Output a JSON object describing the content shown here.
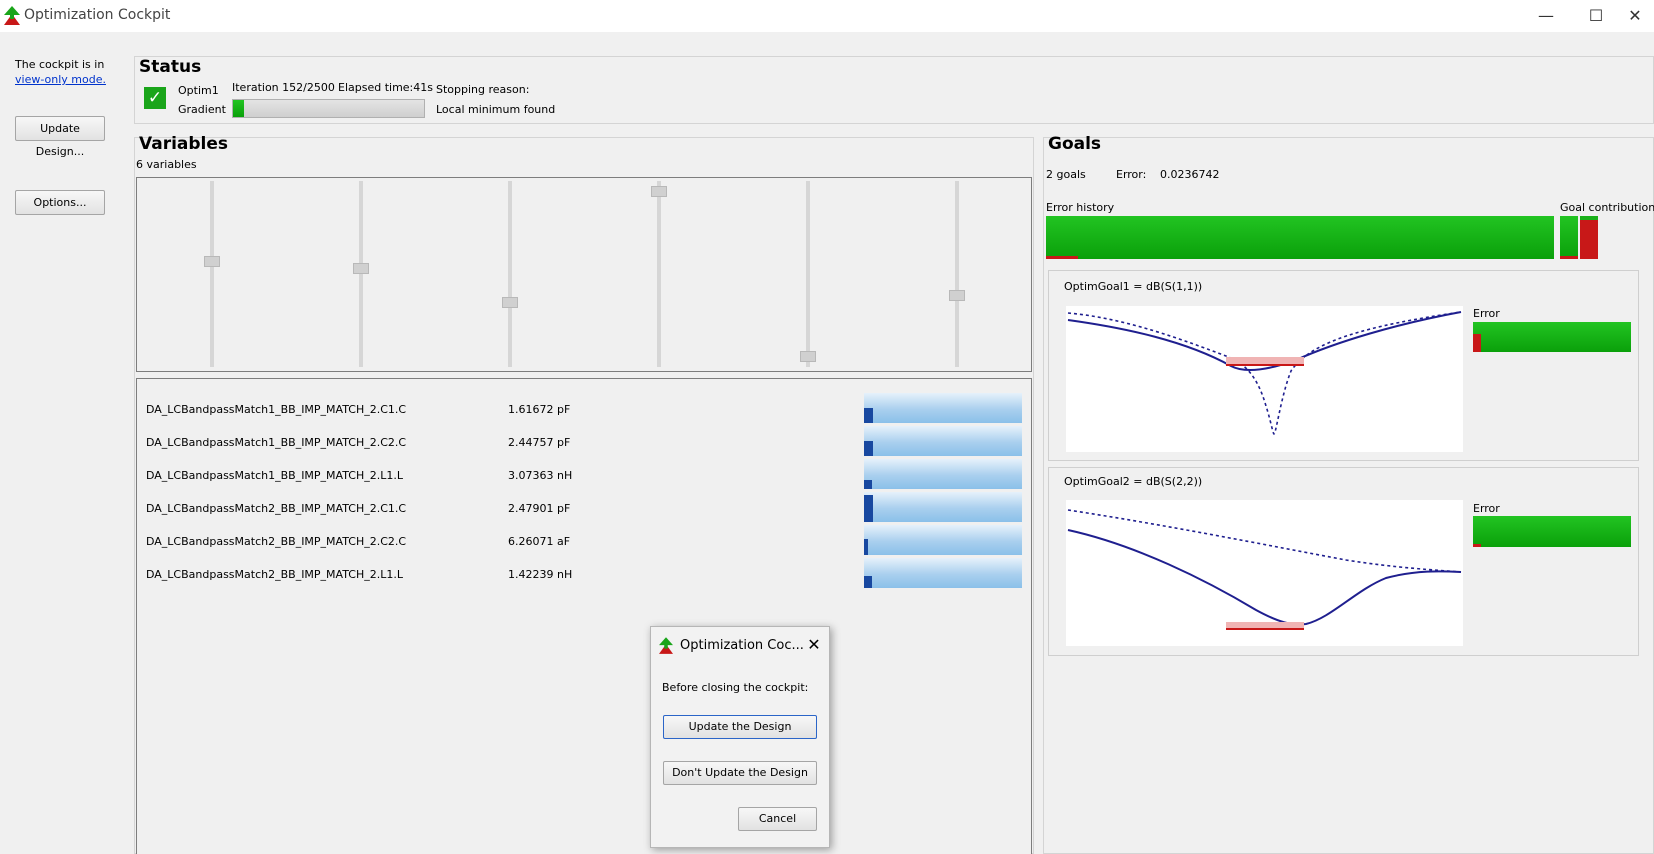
{
  "window": {
    "title": "Optimization Cockpit",
    "minimize": "—",
    "maximize": "☐",
    "close": "✕"
  },
  "sidebar": {
    "mode_text": "The cockpit is in",
    "mode_link": "view-only mode.",
    "update_button": "Update Design...",
    "options_button": "Options..."
  },
  "status": {
    "title": "Status",
    "optim_name": "Optim1",
    "algorithm": "Gradient",
    "iteration": "Iteration 152/2500",
    "elapsed": "Elapsed time:41s",
    "stopping_label": "Stopping reason:",
    "stopping_value": "Local minimum found",
    "progress": 0.06,
    "check_color": "#1aa51a"
  },
  "variables": {
    "title": "Variables",
    "count_text": "6 variables",
    "slider_positions": [
      0.43,
      0.47,
      0.66,
      0.03,
      0.97,
      0.62
    ],
    "rows": [
      {
        "name": "DA_LCBandpassMatch1_BB_IMP_MATCH_2.C1.C",
        "value": "1.61672 pF",
        "fill": 0.06
      },
      {
        "name": "DA_LCBandpassMatch1_BB_IMP_MATCH_2.C2.C",
        "value": "2.44757 pF",
        "fill": 0.06
      },
      {
        "name": "DA_LCBandpassMatch1_BB_IMP_MATCH_2.L1.L",
        "value": "3.07363 nH",
        "fill": 0.05
      },
      {
        "name": "DA_LCBandpassMatch2_BB_IMP_MATCH_2.C1.C",
        "value": "2.47901 pF",
        "fill": 0.06
      },
      {
        "name": "DA_LCBandpassMatch2_BB_IMP_MATCH_2.C2.C",
        "value": "6.26071 aF",
        "fill": 0.02
      },
      {
        "name": "DA_LCBandpassMatch2_BB_IMP_MATCH_2.L1.L",
        "value": "1.42239 nH",
        "fill": 0.05
      }
    ]
  },
  "goals": {
    "title": "Goals",
    "count_text": "2 goals",
    "error_label": "Error:",
    "error_value": "0.0236742",
    "history_label": "Error history",
    "contrib_label": "Goal contributions",
    "colors": {
      "green": "#1ab01a",
      "red": "#c81818",
      "curve": "#1f1f8f"
    },
    "goal1": {
      "title": "OptimGoal1 = dB(S(1,1))",
      "error_label": "Error"
    },
    "goal2": {
      "title": "OptimGoal2 = dB(S(2,2))",
      "error_label": "Error"
    }
  },
  "dialog": {
    "title": "Optimization Coc...",
    "message": "Before closing the cockpit:",
    "update_button": "Update the Design",
    "dont_update_button": "Don't Update the Design",
    "cancel_button": "Cancel"
  }
}
